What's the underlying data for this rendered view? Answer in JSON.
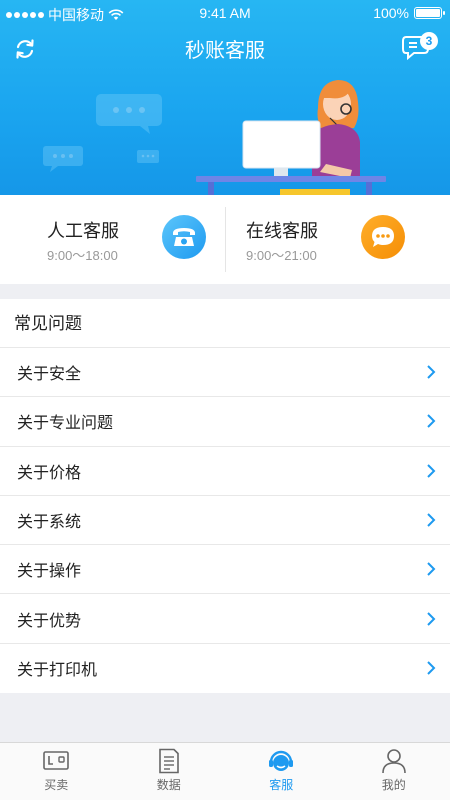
{
  "status_bar": {
    "carrier": "中国移动",
    "time": "9:41 AM",
    "battery": "100%"
  },
  "nav": {
    "title": "秒账客服",
    "refresh_icon": "refresh-icon",
    "chat_icon": "chat-list-icon",
    "chat_badge": "3"
  },
  "contact": {
    "human": {
      "title": "人工客服",
      "hours": "9:00～18:00",
      "icon": "phone-icon"
    },
    "online": {
      "title": "在线客服",
      "hours": "9:00～21:00",
      "icon": "chat-bubble-icon"
    }
  },
  "faq": {
    "header": "常见问题",
    "items": [
      {
        "label": "关于安全"
      },
      {
        "label": "关于专业问题"
      },
      {
        "label": "关于价格"
      },
      {
        "label": "关于系统"
      },
      {
        "label": "关于操作"
      },
      {
        "label": "关于优势"
      },
      {
        "label": "关于打印机"
      }
    ]
  },
  "tabbar": {
    "items": [
      {
        "label": "买卖",
        "icon": "trade-icon"
      },
      {
        "label": "数据",
        "icon": "document-icon"
      },
      {
        "label": "客服",
        "icon": "customer-service-icon",
        "active": true
      },
      {
        "label": "我的",
        "icon": "profile-icon"
      }
    ]
  },
  "colors": {
    "primary": "#1e9af0",
    "banner_top": "#27b6f3",
    "orange": "#f58e06",
    "background": "#eeeff3"
  }
}
